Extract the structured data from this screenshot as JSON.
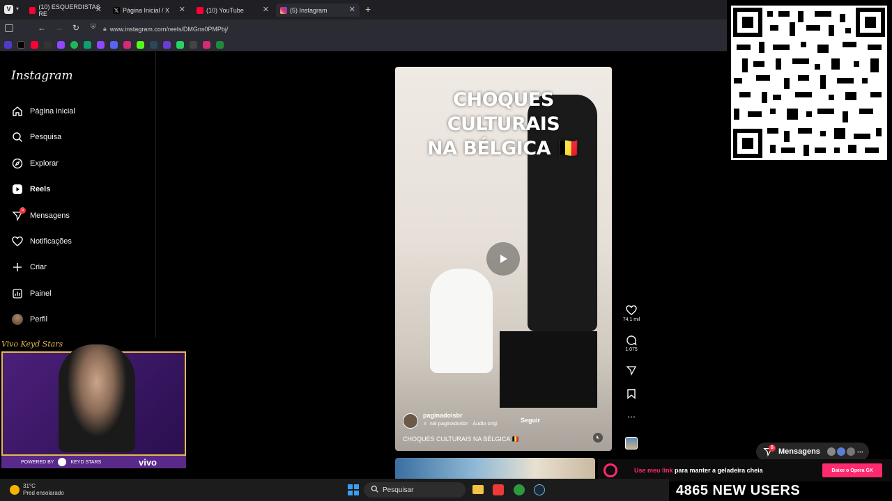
{
  "browser": {
    "tabs": [
      {
        "title": "(10) ESQUERDISTAS RE",
        "icon": "youtube-icon",
        "color": "#ff0033"
      },
      {
        "title": "Página Inicial / X",
        "icon": "x-icon",
        "color": "#ffffff"
      },
      {
        "title": "(10) YouTube",
        "icon": "youtube-icon",
        "color": "#ff0033"
      },
      {
        "title": "(5) Instagram",
        "icon": "instagram-icon",
        "color": "#d62976"
      }
    ],
    "url": "www.instagram.com/reels/DMGns0PMPbj/"
  },
  "instagram": {
    "logo": "Instagram",
    "nav": [
      {
        "label": "Página inicial",
        "icon": "home-icon"
      },
      {
        "label": "Pesquisa",
        "icon": "search-icon"
      },
      {
        "label": "Explorar",
        "icon": "compass-icon"
      },
      {
        "label": "Reels",
        "icon": "reels-icon"
      },
      {
        "label": "Mensagens",
        "icon": "messenger-icon",
        "badge": "5"
      },
      {
        "label": "Notificações",
        "icon": "heart-icon"
      },
      {
        "label": "Criar",
        "icon": "plus-icon"
      },
      {
        "label": "Painel",
        "icon": "dashboard-icon"
      },
      {
        "label": "Perfil",
        "icon": "avatar-icon"
      }
    ],
    "reel": {
      "title_line1": "CHOQUES CULTURAIS",
      "title_line2": "NA BÉLGICA 🇧🇪",
      "author": "paginadoisbr",
      "audio": "♬ nal      paginadoisbr · Áudio origi",
      "follow": "Seguir",
      "caption": "CHOQUES CULTURAIS NA BÉLGICA 🇧🇪"
    },
    "actions": {
      "likes": "74,1 mil",
      "comments": "1.075"
    },
    "messages_pill": {
      "label": "Mensagens",
      "badge": "5"
    }
  },
  "overlays": {
    "cam_signature": "Vivo Keyd Stars",
    "cam_powered": "POWERED BY",
    "cam_team": "KEYD STARS",
    "cam_sponsor": "vivo",
    "opera_text_pink": "Use meu link",
    "opera_text_white": " para manter a geladeira cheia",
    "opera_button": "Baixe o Opera GX",
    "new_users": "4865 NEW USERS"
  },
  "taskbar": {
    "temp": "31°C",
    "weather": "Pred ensolarado",
    "search_placeholder": "Pesquisar"
  }
}
